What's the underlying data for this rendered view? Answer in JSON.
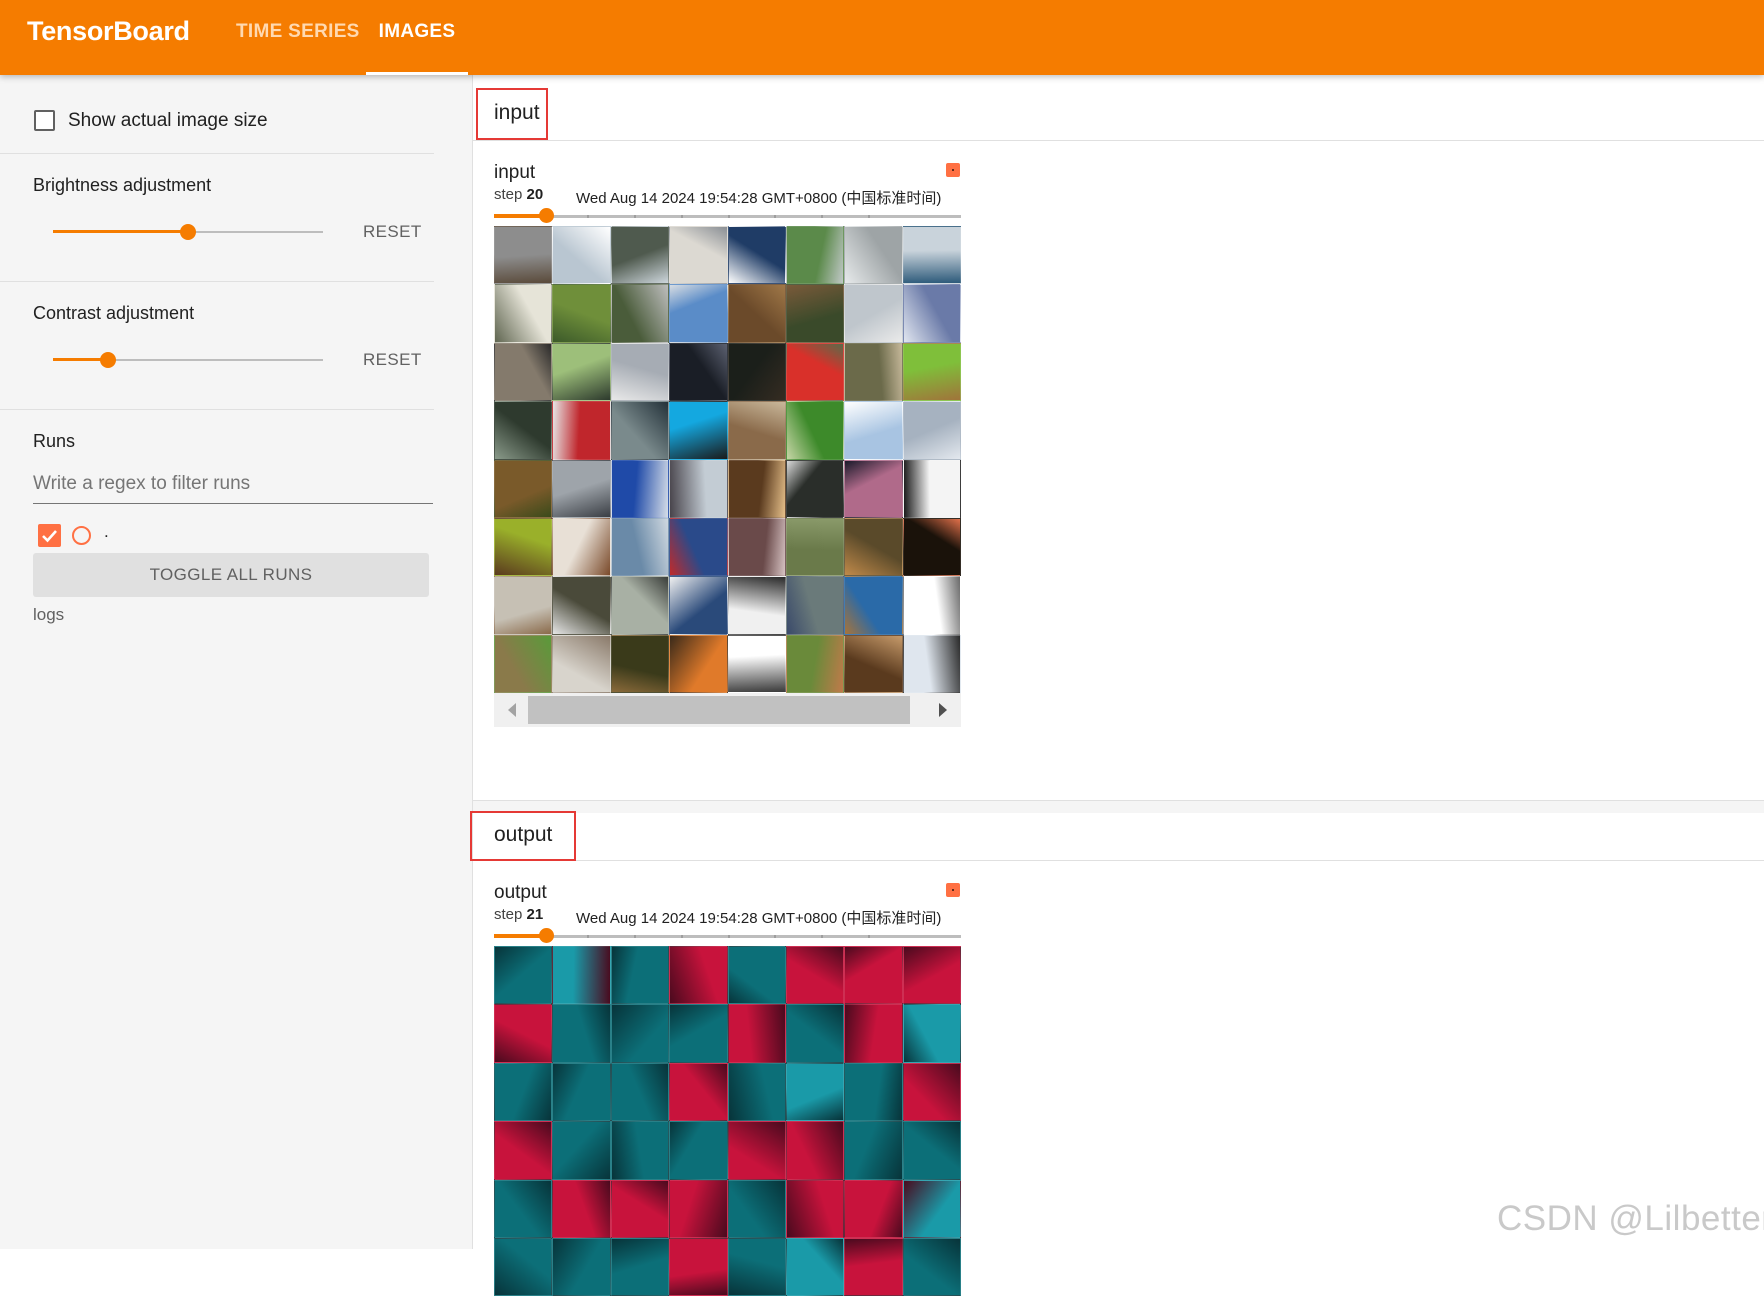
{
  "app": {
    "title": "TensorBoard",
    "tabs": [
      {
        "label": "TIME SERIES",
        "active": false
      },
      {
        "label": "IMAGES",
        "active": true
      }
    ]
  },
  "sidebar": {
    "show_actual_size": {
      "label": "Show actual image size",
      "checked": false
    },
    "brightness": {
      "label": "Brightness adjustment",
      "reset": "RESET",
      "value_fraction": 0.5
    },
    "contrast": {
      "label": "Contrast adjustment",
      "reset": "RESET",
      "value_fraction": 0.2
    },
    "runs": {
      "title": "Runs",
      "filter_placeholder": "Write a regex to filter runs",
      "run_name": ".",
      "run_checked": true,
      "toggle_all": "TOGGLE ALL RUNS",
      "logdir": "logs"
    }
  },
  "sections": [
    {
      "header": "input",
      "card": {
        "title": "input",
        "step_label": "step",
        "step": "20",
        "timestamp": "Wed Aug 14 2024 19:54:28 GMT+0800 (中国标准时间)",
        "slider_fraction": 0.1,
        "grid_style": "natural-photos"
      }
    },
    {
      "header": "output",
      "card": {
        "title": "output",
        "step_label": "step",
        "step": "21",
        "timestamp": "Wed Aug 14 2024 19:54:28 GMT+0800 (中国标准时间)",
        "slider_fraction": 0.1,
        "grid_style": "teal-red-tint"
      }
    }
  ],
  "colors": {
    "accent": "#f57c00",
    "run": "#ff7043",
    "highlight": "#e53935"
  },
  "watermark": "CSDN @Lilbetter."
}
